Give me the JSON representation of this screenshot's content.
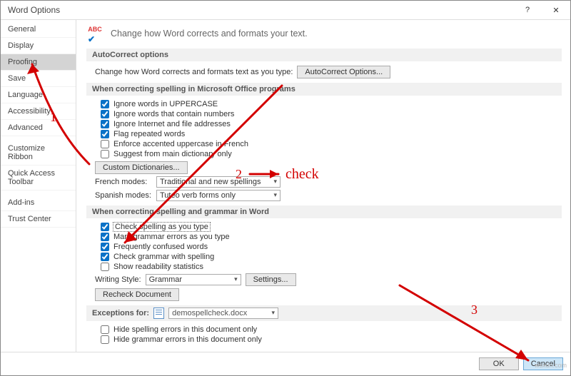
{
  "window": {
    "title": "Word Options"
  },
  "sidebar": {
    "items": [
      "General",
      "Display",
      "Proofing",
      "Save",
      "Language",
      "Accessibility",
      "Advanced",
      "Customize Ribbon",
      "Quick Access Toolbar",
      "Add-ins",
      "Trust Center"
    ],
    "selected": "Proofing"
  },
  "header": "Change how Word corrects and formats your text.",
  "sections": {
    "autocorrect": {
      "title": "AutoCorrect options",
      "line": "Change how Word corrects and formats text as you type:",
      "button": "AutoCorrect Options..."
    },
    "office": {
      "title": "When correcting spelling in Microsoft Office programs",
      "cb": [
        {
          "label": "Ignore words in UPPERCASE",
          "checked": true
        },
        {
          "label": "Ignore words that contain numbers",
          "checked": true
        },
        {
          "label": "Ignore Internet and file addresses",
          "checked": true
        },
        {
          "label": "Flag repeated words",
          "checked": true
        },
        {
          "label": "Enforce accented uppercase in French",
          "checked": false
        },
        {
          "label": "Suggest from main dictionary only",
          "checked": false
        }
      ],
      "dict_button": "Custom Dictionaries...",
      "french_label": "French modes:",
      "french_value": "Traditional and new spellings",
      "spanish_label": "Spanish modes:",
      "spanish_value": "Tuteo verb forms only"
    },
    "word": {
      "title": "When correcting spelling and grammar in Word",
      "cb": [
        {
          "label": "Check spelling as you type",
          "checked": true
        },
        {
          "label": "Mark grammar errors as you type",
          "checked": true
        },
        {
          "label": "Frequently confused words",
          "checked": true
        },
        {
          "label": "Check grammar with spelling",
          "checked": true
        },
        {
          "label": "Show readability statistics",
          "checked": false
        }
      ],
      "style_label": "Writing Style:",
      "style_value": "Grammar",
      "settings_button": "Settings...",
      "recheck_button": "Recheck Document"
    },
    "exceptions": {
      "title_prefix": "Exceptions for:",
      "doc": "demospellcheck.docx",
      "cb": [
        {
          "label": "Hide spelling errors in this document only",
          "checked": false
        },
        {
          "label": "Hide grammar errors in this document only",
          "checked": false
        }
      ]
    }
  },
  "footer": {
    "ok": "OK",
    "cancel": "Cancel"
  },
  "annotations": {
    "a1": "1",
    "a2": "2",
    "a2b": "check",
    "a3": "3"
  },
  "watermark": "wsxdn.com"
}
